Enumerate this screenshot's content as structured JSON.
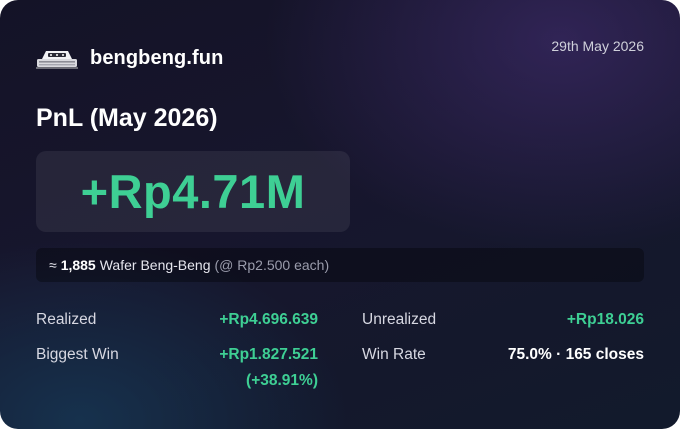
{
  "header": {
    "brand": "bengbeng.fun",
    "logo_icon": "wafer-logo-icon",
    "date": "29th May 2026"
  },
  "pnl": {
    "title": "PnL (May 2026)",
    "value": "+Rp4.71M"
  },
  "wafer": {
    "prefix": "≈",
    "count": "1,885",
    "name": "Wafer Beng-Beng",
    "price_note": "(@ Rp2.500 each)"
  },
  "stats": {
    "realized_label": "Realized",
    "realized_value": "+Rp4.696.639",
    "unrealized_label": "Unrealized",
    "unrealized_value": "+Rp18.026",
    "biggest_win_label": "Biggest Win",
    "biggest_win_value": "+Rp1.827.521",
    "biggest_win_pct": "(+38.91%)",
    "win_rate_label": "Win Rate",
    "win_rate_value": "75.0% · 165 closes"
  },
  "colors": {
    "positive": "#3ecf94",
    "background": "#15152a"
  }
}
